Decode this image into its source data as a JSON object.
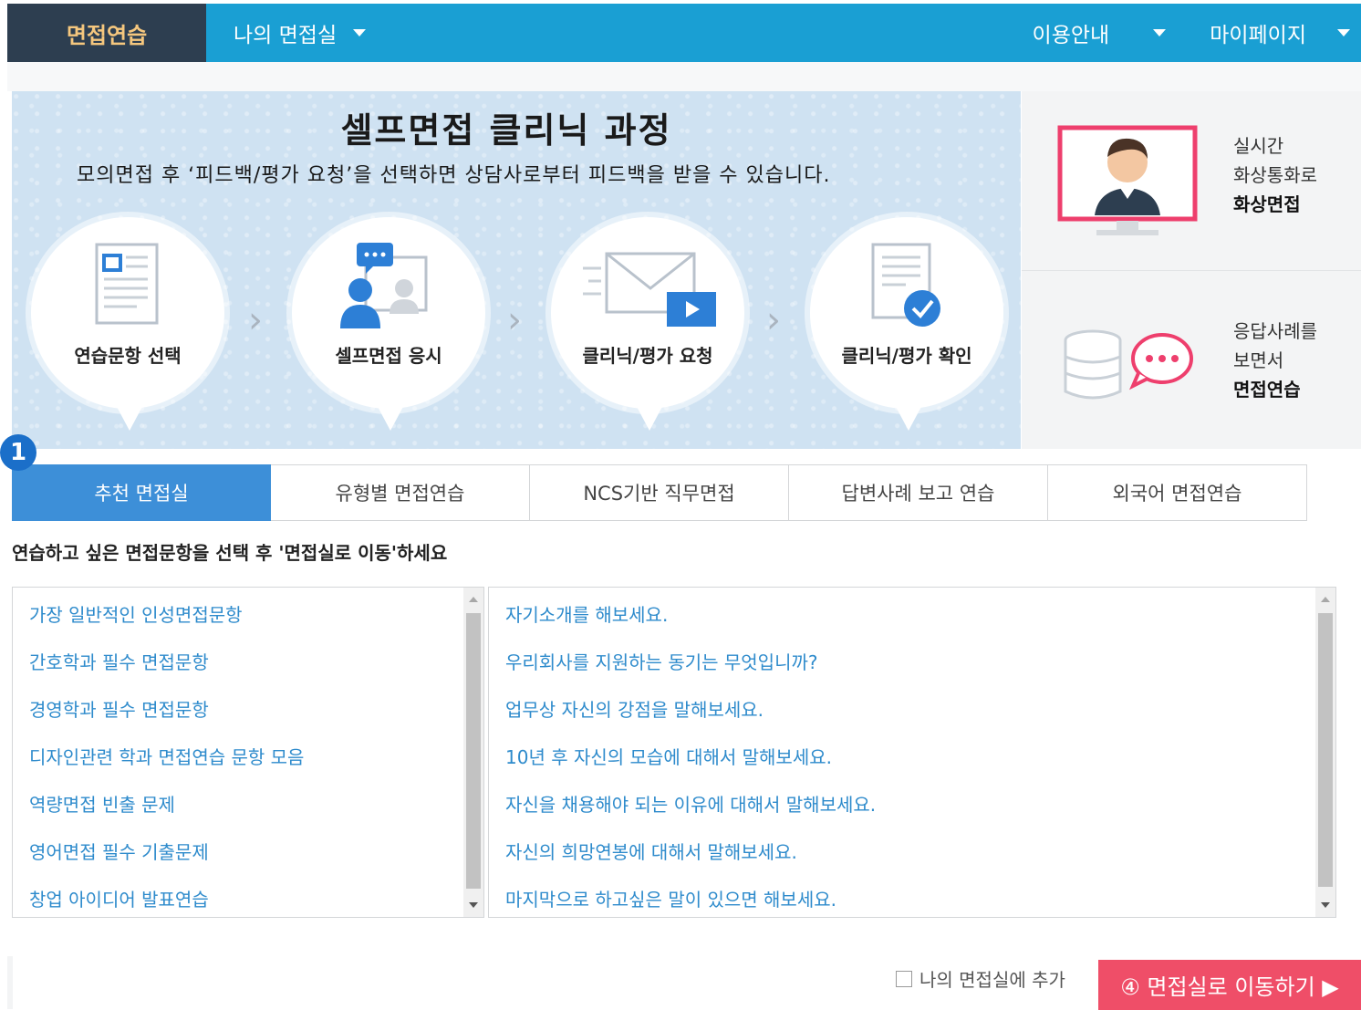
{
  "nav": {
    "home": "면접연습",
    "my_room": "나의 면접실",
    "guide": "이용안내",
    "mypage": "마이페이지"
  },
  "banner": {
    "title": "셀프면접 클리닉 과정",
    "subtitle": "모의면접 후 ‘피드백/평가 요청’을 선택하면 상담사로부터 피드백을 받을 수 있습니다.",
    "steps": [
      {
        "label": "연습문항 선택",
        "icon": "document-icon"
      },
      {
        "label": "셀프면접 응시",
        "icon": "interview-people-icon"
      },
      {
        "label": "클리닉/평가 요청",
        "icon": "envelope-video-icon"
      },
      {
        "label": "클리닉/평가 확인",
        "icon": "document-check-icon"
      }
    ]
  },
  "side": {
    "video": {
      "line1": "실시간",
      "line2": "화상통화로",
      "bold": "화상면접"
    },
    "examples": {
      "line1": "응답사례를",
      "line2": "보면서",
      "bold": "면접연습"
    }
  },
  "badge": "1",
  "tabs": [
    {
      "label": "추천 면접실",
      "active": true
    },
    {
      "label": "유형별 면접연습",
      "active": false
    },
    {
      "label": "NCS기반 직무면접",
      "active": false
    },
    {
      "label": "답변사례 보고 연습",
      "active": false
    },
    {
      "label": "외국어 면접연습",
      "active": false
    }
  ],
  "instruction": "연습하고 싶은 면접문항을 선택 후 '면접실로 이동'하세요",
  "categories": [
    "가장 일반적인 인성면접문항",
    "간호학과 필수 면접문항",
    "경영학과 필수 면접문항",
    "디자인관련 학과 면접연습 문항 모음",
    "역량면접 빈출 문제",
    "영어면접 필수 기출문제",
    "창업 아이디어 발표연습"
  ],
  "questions": [
    "자기소개를 해보세요.",
    "우리회사를 지원하는 동기는 무엇입니까?",
    "업무상 자신의 강점을 말해보세요.",
    "10년 후 자신의 모습에 대해서 말해보세요.",
    "자신을 채용해야 되는 이유에 대해서 말해보세요.",
    "자신의 희망연봉에 대해서 말해보세요.",
    "마지막으로 하고싶은 말이 있으면 해보세요."
  ],
  "bottom": {
    "checkbox_label": "나의 면접실에 추가",
    "go_button": "④ 면접실로 이동하기 ▶"
  },
  "colors": {
    "nav_bg": "#1a9fd3",
    "nav_home_bg": "#2d3e50",
    "tab_active": "#3d8fd8",
    "link": "#2e8bcc",
    "go_button": "#ef4e68",
    "badge": "#1b6fc9"
  }
}
